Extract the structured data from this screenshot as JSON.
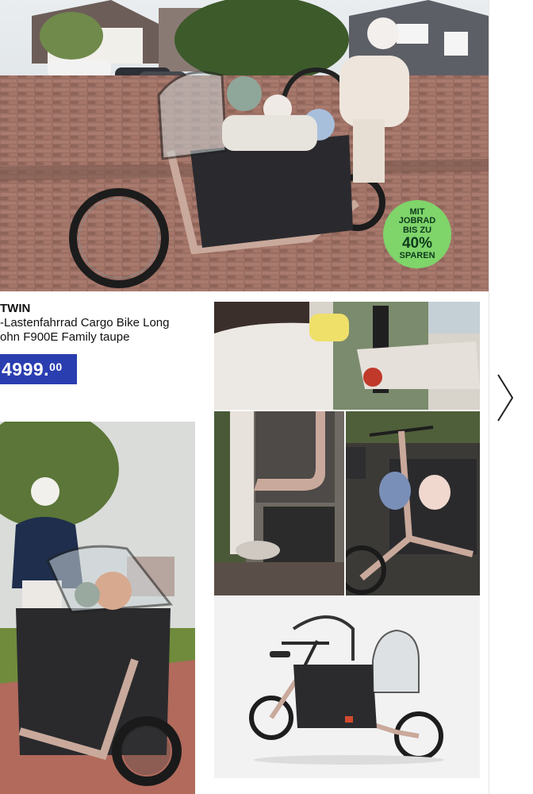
{
  "product": {
    "brand": "TWIN",
    "name_line1": "-Lastenfahrrad Cargo Bike Long",
    "name_line2": "ohn F900E Family taupe",
    "price_main": "4999.",
    "price_cents": "00"
  },
  "promo_badge": {
    "line1": "MIT",
    "line2": "JOBRAD",
    "line3": "BIS ZU",
    "percent": "40%",
    "line5": "SPAREN",
    "color": "#7fd46a"
  },
  "navigation": {
    "next_icon": "chevron-right-icon"
  },
  "colors": {
    "price_bg": "#2a3eb0",
    "bike_frame": "#c9a99b",
    "bike_box": "#2a2a2e"
  },
  "images": [
    "hero-family-cargo-bike-photo",
    "detail-child-harness-photo",
    "detail-seat-box-photo",
    "detail-helmets-in-box-photo",
    "rider-on-path-photo",
    "product-studio-photo"
  ]
}
